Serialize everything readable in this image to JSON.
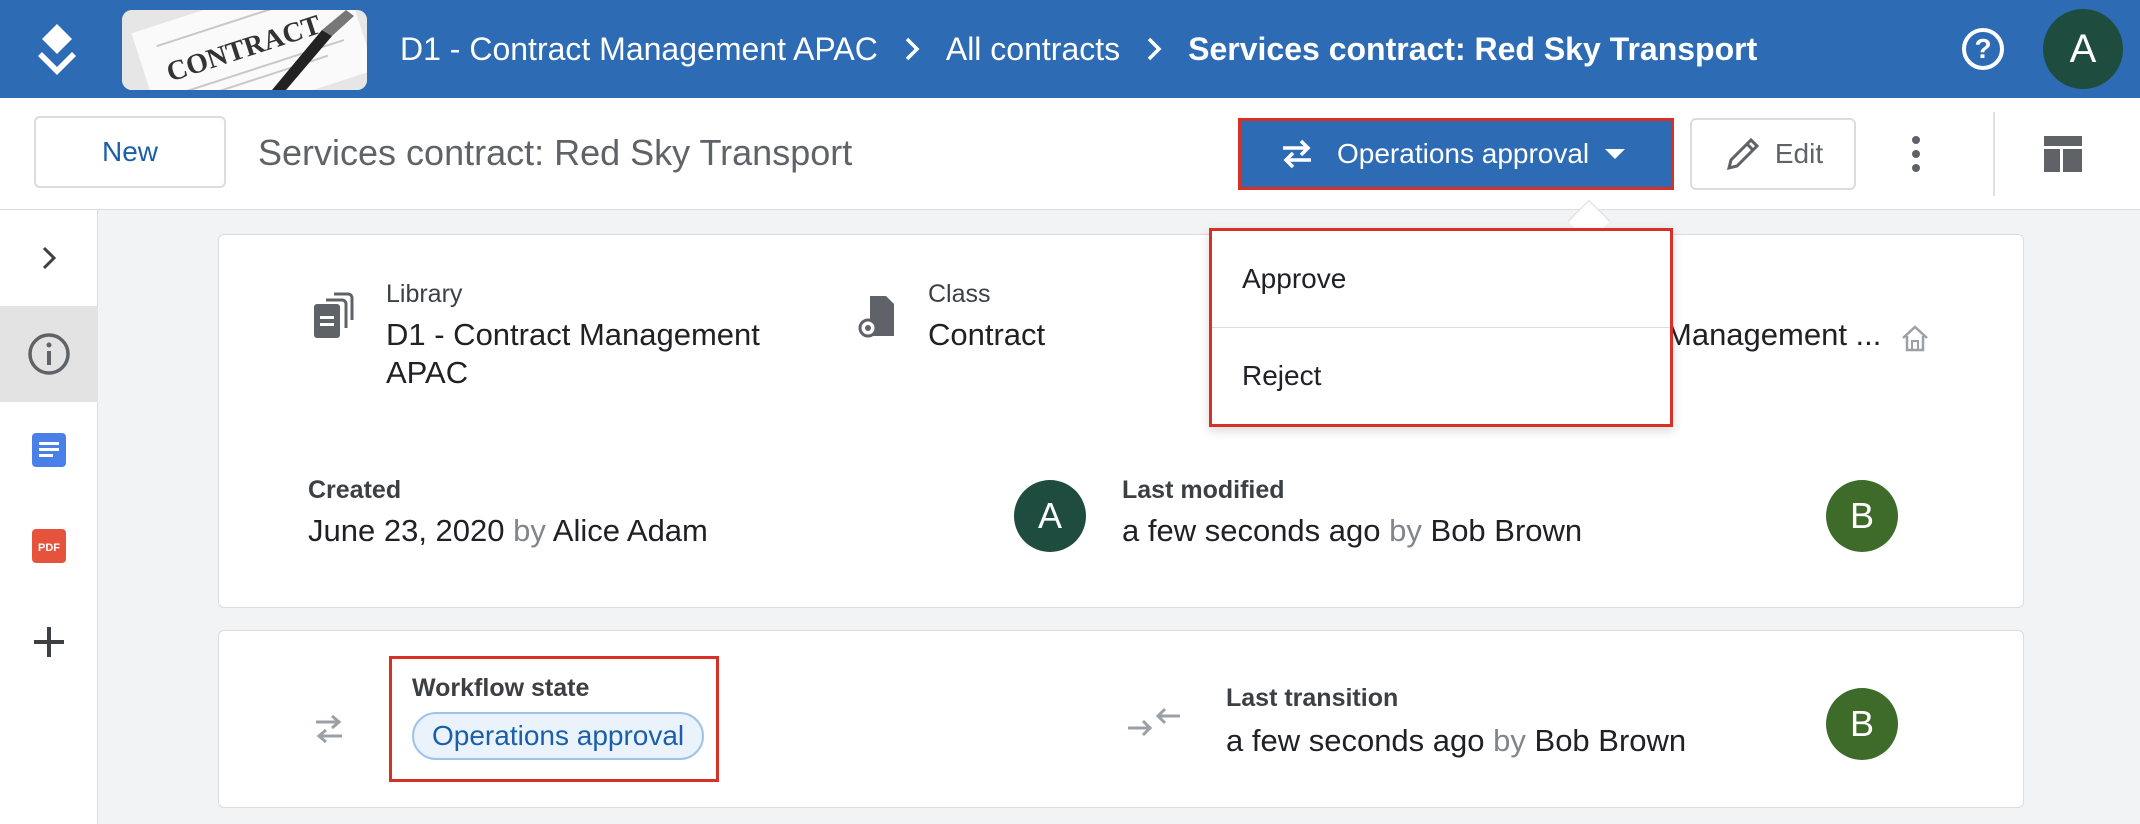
{
  "header": {
    "breadcrumbs": [
      "D1 - Contract Management APAC",
      "All contracts",
      "Services contract: Red Sky Transport"
    ],
    "banner_text": "CONTRACT",
    "help": "?",
    "user_initial": "A"
  },
  "toolbar": {
    "new_label": "New",
    "title": "Services contract: Red Sky Transport",
    "workflow_label": "Operations approval",
    "edit_label": "Edit"
  },
  "menu": {
    "items": [
      "Approve",
      "Reject"
    ]
  },
  "info": {
    "library_label": "Library",
    "library_value": "D1 - Contract Management APAC",
    "class_label": "Class",
    "class_value": "Contract",
    "location_value": "Management ...",
    "created_label": "Created",
    "created_date": "June 23, 2020",
    "by": "by",
    "created_by": "Alice Adam",
    "created_initial": "A",
    "modified_label": "Last modified",
    "modified_when": "a few seconds ago",
    "modified_by": "Bob Brown",
    "modified_initial": "B"
  },
  "workflow": {
    "state_label": "Workflow state",
    "state_value": "Operations approval",
    "transition_label": "Last transition",
    "transition_when": "a few seconds ago",
    "by": "by",
    "transition_by": "Bob Brown",
    "transition_initial": "B"
  },
  "colors": {
    "header_blue": "#2e6bb5",
    "highlight_red": "#d93025",
    "avatar_alice": "#1e4d3f",
    "avatar_bob": "#3f6b2a"
  }
}
